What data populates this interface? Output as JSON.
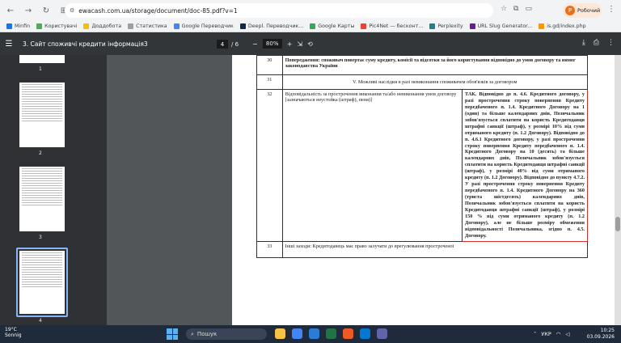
{
  "browser": {
    "url": "ewacash.com.ua/storage/document/doc-85.pdf?v=1",
    "profile_label": "Робочий",
    "profile_initial": "Р"
  },
  "bookmarks": [
    {
      "label": "Minfin",
      "color": "#1a73e8"
    },
    {
      "label": "Користувачі",
      "color": "#4caf50"
    },
    {
      "label": "Доддобота",
      "color": "#fbbc04"
    },
    {
      "label": "Статистика",
      "color": "#9e9e9e"
    },
    {
      "label": "Google Переводчик",
      "color": "#4285f4"
    },
    {
      "label": "Deepl. Переводчик...",
      "color": "#0f2b46"
    },
    {
      "label": "Google Карты",
      "color": "#34a853"
    },
    {
      "label": "Pic4Net — бесконт...",
      "color": "#ea4335"
    },
    {
      "label": "Perplexity",
      "color": "#20808d"
    },
    {
      "label": "URL Slug Generator...",
      "color": "#6a1b9a"
    },
    {
      "label": "is.gd/index.php",
      "color": "#ff9800"
    }
  ],
  "pdf": {
    "title": "3. Сайт споживчі кредити інформація3",
    "current_page": "4",
    "total_pages": "/ 6",
    "zoom": "80%"
  },
  "thumbnails": [
    {
      "num": "1"
    },
    {
      "num": "2"
    },
    {
      "num": "3"
    },
    {
      "num": "4"
    }
  ],
  "document": {
    "row30": {
      "num": "30",
      "text": "Попередження: споживач повертає суму кредиту, комісії та відсотки за його користування відповідно до умов договору та вимог законодавства України"
    },
    "row31": {
      "num": "31",
      "text": "V. Можливі наслідки в разі невиконання споживачем обов'язків за договором"
    },
    "row32": {
      "num": "32",
      "left": "Відповідальність за прострочення виконання та/або невиконання умов договору [зазначаються неустойка (штраф), пеня)]",
      "answer": "ТАК. Відповідно до п. 4.6. Кредитного договору, у разі прострочення строку повернення Кредиту передбаченого п. 1.4. Кредитного Договору на 1 (один) та більше календарних днів, Позичальник зобов'язується сплатити на користь Кредитодавця штрафні санкції (штраф), у розмірі 10% від суми отриманого кредиту (п. 1.2 Договору). Відповідно до п. 4.6.1 Кредитного договору, у разі прострочення строку повернення Кредиту передбаченого п. 1.4. Кредитного Договору на 10 (десять) та більше календарних днів, Позичальник зобов'язується сплатити на користь Кредитодавця штрафні санкції (штраф), у розмірі 40% від суми отриманого кредиту (п. 1.2 Договору). Відповідно до пункту 4.7.2. У разі прострочення строку повернення Кредиту передбаченого п. 1.4. Кредитного Договору на 360 (триста шістдесять) календарних днів, Позичальник зобов'язується сплатити на користь Кредитодавця штрафні санкції (штраф), у розмірі 150 % від суми отриманого кредиту (п. 1.2 Договору), але не більше розміру обмеження відповідальності Позичальника, згідно п. 4.5. Договору."
    },
    "row33": {
      "num": "33",
      "text": "Інші заходи: Кредитодавець має право залучати до врегулювання простроченої"
    }
  },
  "taskbar": {
    "temp": "19°C",
    "weather": "Sonnig",
    "search": "Пошук",
    "lang": "УКР",
    "time": "10:25",
    "date": "03.09.2026"
  }
}
